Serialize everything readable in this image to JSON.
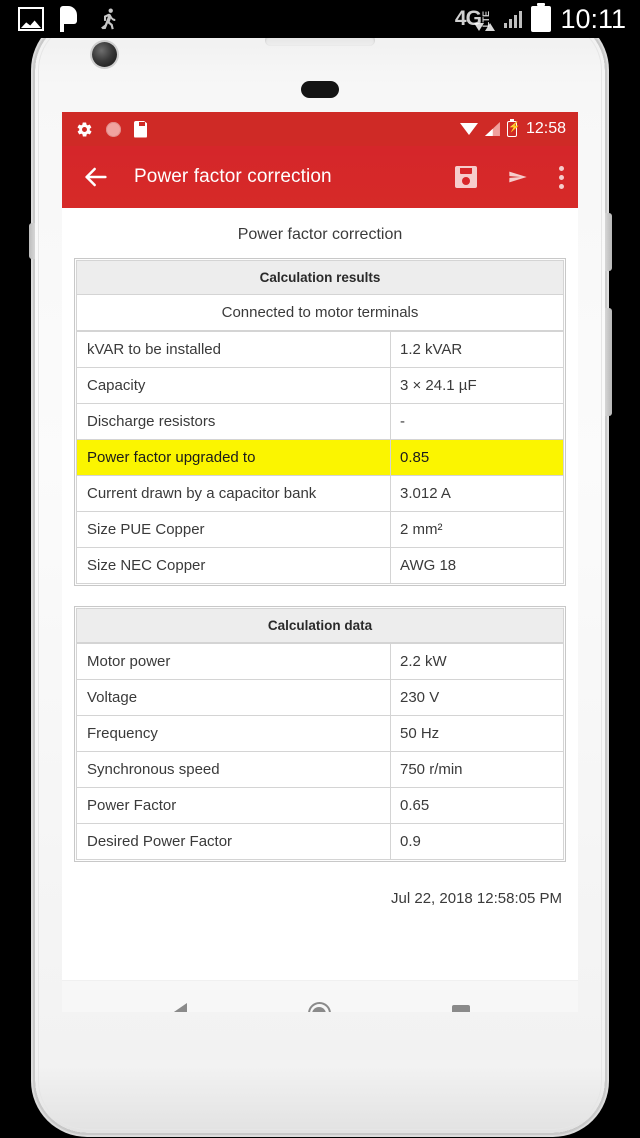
{
  "host_status_bar": {
    "icons_left": [
      "screenshot-icon",
      "flag-icon",
      "runner-icon"
    ],
    "network_label": "4G",
    "network_sub": "LTE",
    "icons_right": [
      "signal-bars-icon",
      "battery-icon"
    ],
    "clock": "10:11"
  },
  "app": {
    "status_bar": {
      "icons_left": [
        "gear-icon",
        "record-circle-icon",
        "sd-card-icon"
      ],
      "icons_right": [
        "wifi-icon",
        "cell-signal-icon",
        "battery-charging-icon"
      ],
      "clock": "12:58"
    },
    "toolbar": {
      "back_label": "Back",
      "title": "Power factor correction",
      "save_label": "Save",
      "send_label": "Send",
      "more_label": "More options"
    },
    "page_heading": "Power factor correction",
    "results_table": {
      "header": "Calculation results",
      "subheader": "Connected to motor terminals",
      "rows": [
        {
          "key": "kVAR to be installed",
          "value": "1.2 kVAR",
          "highlight": false
        },
        {
          "key": "Capacity",
          "value": "3 × 24.1 µF",
          "highlight": false
        },
        {
          "key": "Discharge resistors",
          "value": "-",
          "highlight": false
        },
        {
          "key": "Power factor upgraded to",
          "value": "0.85",
          "highlight": true
        },
        {
          "key": "Current drawn by a capacitor bank",
          "value": "3.012 A",
          "highlight": false
        },
        {
          "key": "Size PUE Copper",
          "value": "2 mm²",
          "highlight": false
        },
        {
          "key": "Size NEC Copper",
          "value": "AWG 18",
          "highlight": false
        }
      ]
    },
    "data_table": {
      "header": "Calculation data",
      "rows": [
        {
          "key": "Motor power",
          "value": "2.2 kW"
        },
        {
          "key": "Voltage",
          "value": "230 V"
        },
        {
          "key": "Frequency",
          "value": "50 Hz"
        },
        {
          "key": "Synchronous speed",
          "value": "750 r/min"
        },
        {
          "key": "Power Factor",
          "value": "0.65"
        },
        {
          "key": "Desired Power Factor",
          "value": "0.9"
        }
      ]
    },
    "timestamp": "Jul 22, 2018 12:58:05 PM",
    "nav_bar": {
      "back": "back-icon",
      "home": "home-icon",
      "recents": "recents-icon"
    }
  },
  "colors": {
    "toolbar_red": "#d8272a",
    "status_red": "#cf2a26",
    "highlight_yellow": "#fbf500",
    "table_header_gray": "#ededed",
    "border_gray": "#d4d4d4"
  }
}
